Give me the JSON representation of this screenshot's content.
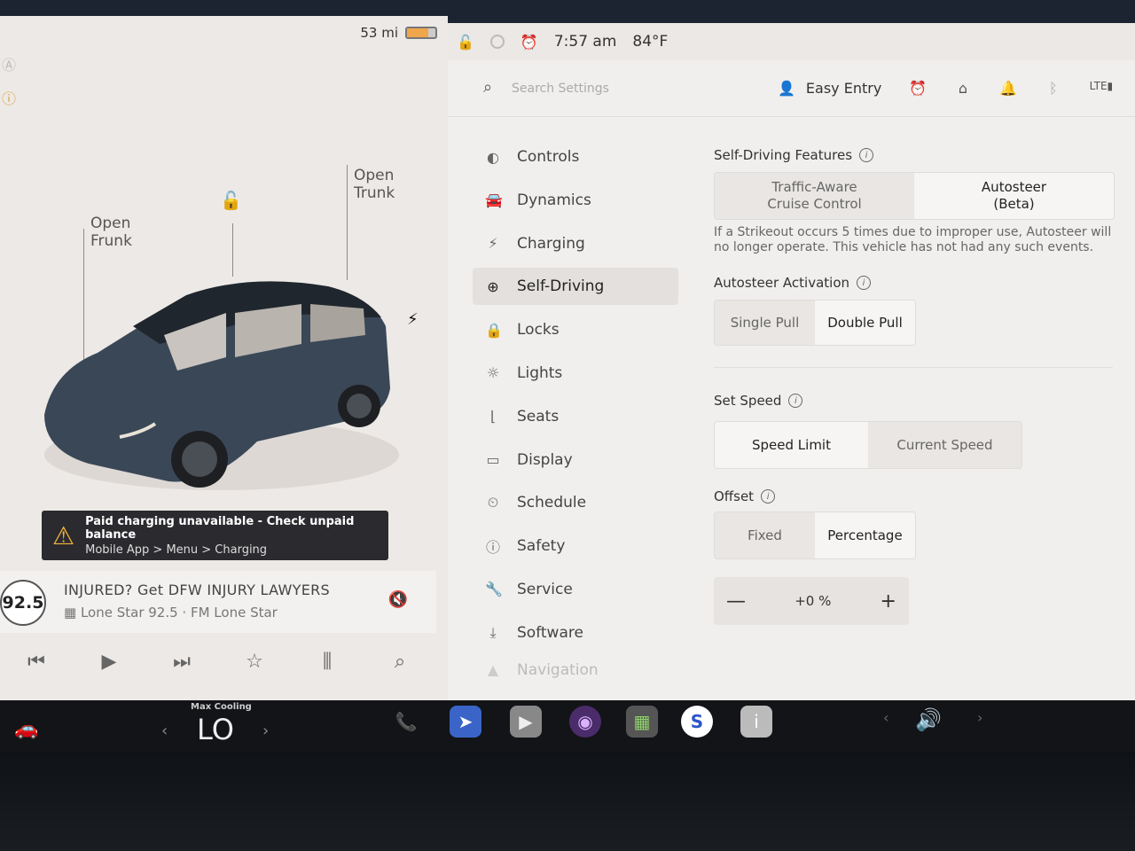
{
  "left": {
    "range": "53 mi",
    "battery_level": 0.75,
    "open_frunk": "Open\nFrunk",
    "open_trunk": "Open\nTrunk",
    "alert": {
      "title": "Paid charging unavailable - Check unpaid balance",
      "subtitle": "Mobile App > Menu > Charging"
    },
    "media": {
      "station_badge": "92.5",
      "title": "INJURED? Get DFW INJURY LAWYERS",
      "station": "Lone Star 92.5 · FM Lone Star"
    }
  },
  "status": {
    "time": "7:57 am",
    "temp": "84°F"
  },
  "header": {
    "search_placeholder": "Search Settings",
    "profile": "Easy Entry"
  },
  "nav": {
    "items": [
      {
        "label": "Controls"
      },
      {
        "label": "Dynamics"
      },
      {
        "label": "Charging"
      },
      {
        "label": "Self-Driving"
      },
      {
        "label": "Locks"
      },
      {
        "label": "Lights"
      },
      {
        "label": "Seats"
      },
      {
        "label": "Display"
      },
      {
        "label": "Schedule"
      },
      {
        "label": "Safety"
      },
      {
        "label": "Service"
      },
      {
        "label": "Software"
      },
      {
        "label": "Navigation"
      }
    ]
  },
  "settings": {
    "features_title": "Self-Driving Features",
    "features_options": [
      "Traffic-Aware\nCruise Control",
      "Autosteer\n(Beta)"
    ],
    "strikeout_note": "If a Strikeout occurs 5 times due to improper use, Autosteer will no longer operate. This vehicle has not had any such events.",
    "activation_title": "Autosteer Activation",
    "activation_options": [
      "Single Pull",
      "Double Pull"
    ],
    "speed_title": "Set Speed",
    "speed_options": [
      "Speed Limit",
      "Current Speed"
    ],
    "offset_title": "Offset",
    "offset_options": [
      "Fixed",
      "Percentage"
    ],
    "offset_value": "+0 %"
  },
  "taskbar": {
    "climate_label": "Max Cooling",
    "climate_temp": "LO"
  }
}
